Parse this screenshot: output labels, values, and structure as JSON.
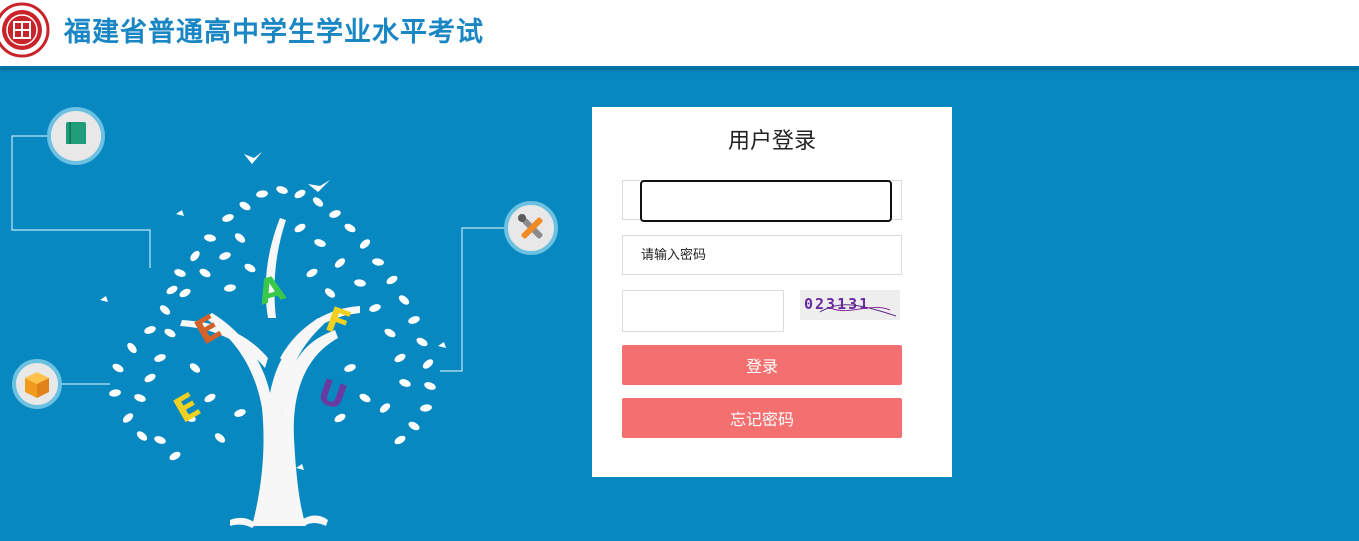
{
  "header": {
    "title": "福建省普通高中学生学业水平考试",
    "logo_icon": "exam-seal-logo"
  },
  "decoration": {
    "icons": [
      "book-icon",
      "tools-icon",
      "cube-icon"
    ],
    "tree_letters": [
      "A",
      "E",
      "E",
      "F",
      "U"
    ],
    "background_color": "#0888c0"
  },
  "login": {
    "title": "用户登录",
    "username_value": "",
    "password_placeholder": "请输入密码",
    "captcha_value": "",
    "captcha_text": "023131",
    "login_button": "登录",
    "forgot_button": "忘记密码",
    "button_color": "#f47070"
  }
}
